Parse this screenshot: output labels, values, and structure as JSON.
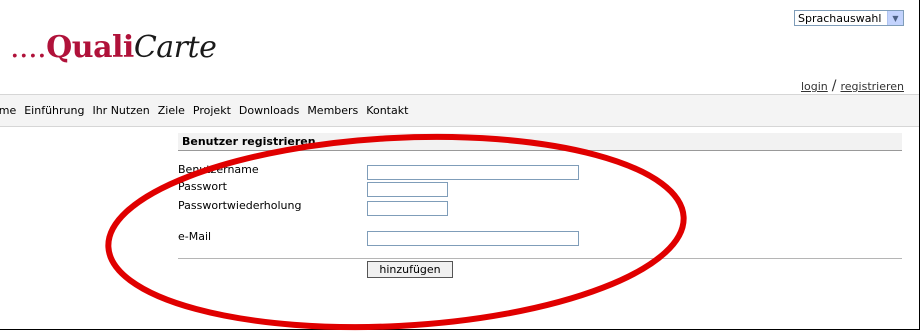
{
  "language_select": {
    "value": "Sprachauswahl"
  },
  "logo": {
    "dots": "....",
    "part1": "Quali",
    "part2": "Carte"
  },
  "auth": {
    "login": "login",
    "separator": "/",
    "register": "registrieren"
  },
  "nav": {
    "items": [
      "ome",
      "Einführung",
      "Ihr Nutzen",
      "Ziele",
      "Projekt",
      "Downloads",
      "Members",
      "Kontakt"
    ]
  },
  "form": {
    "title": "Benutzer registrieren",
    "labels": {
      "username": "Benutzername",
      "password": "Passwort",
      "password_repeat": "Passwortwiederholung",
      "email": "e-Mail"
    },
    "values": {
      "username": "",
      "password": "",
      "password_repeat": "",
      "email": ""
    },
    "submit": "hinzufügen"
  },
  "colors": {
    "brand": "#b0123a",
    "annotation": "#e00000"
  }
}
